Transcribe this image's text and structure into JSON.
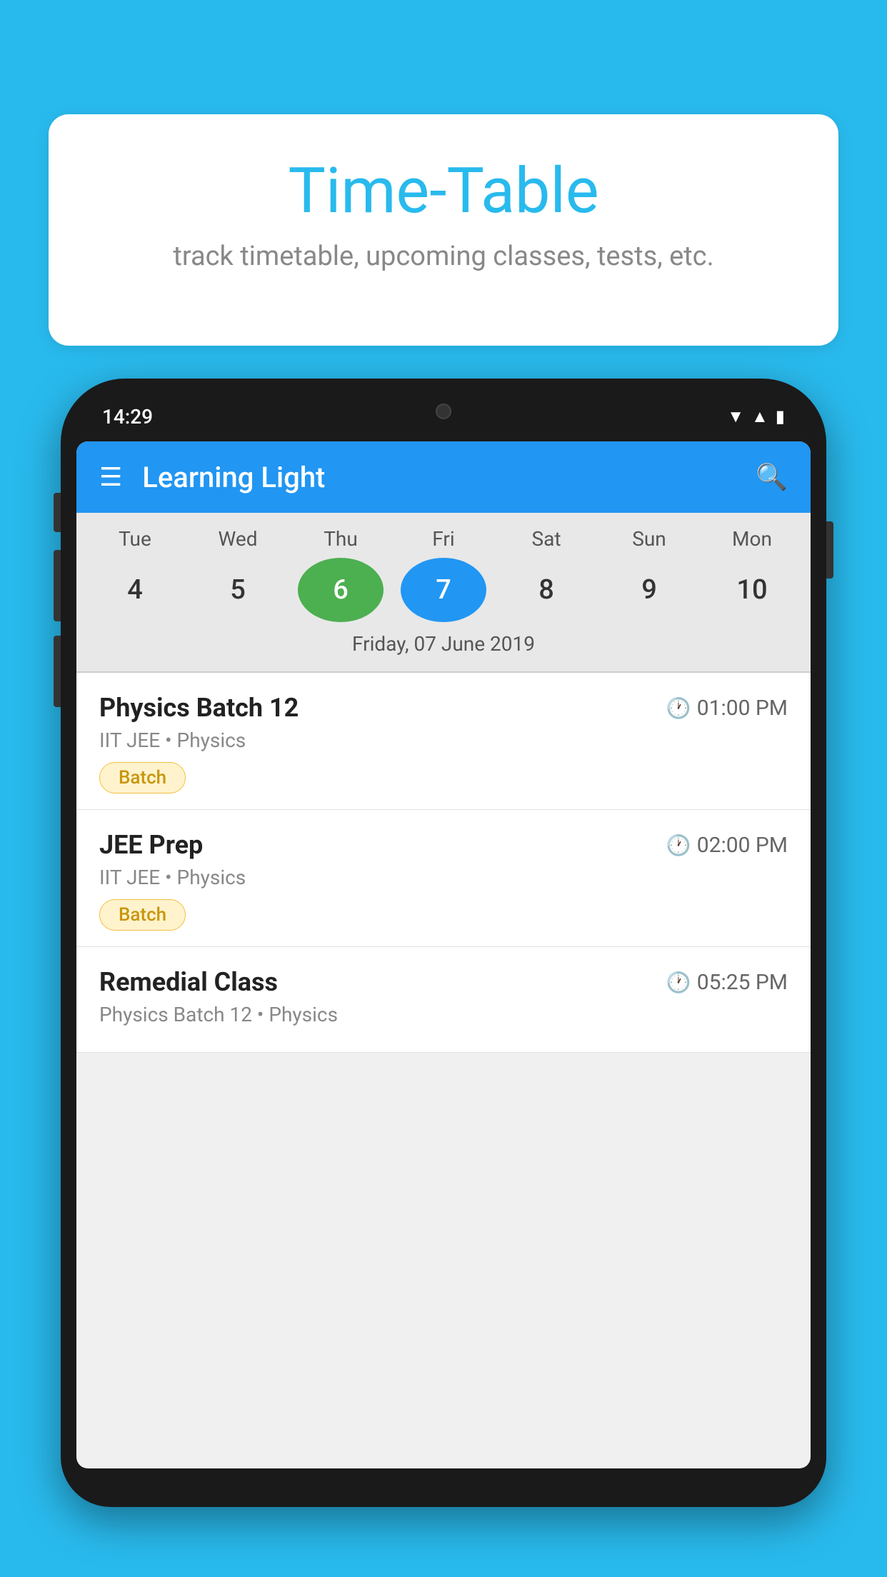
{
  "background_color": "#29BAED",
  "speech_bubble": {
    "title": "Time-Table",
    "subtitle": "track timetable, upcoming classes, tests, etc."
  },
  "phone": {
    "status_bar": {
      "time": "14:29"
    },
    "app_bar": {
      "title": "Learning Light",
      "menu_icon": "hamburger-icon",
      "search_icon": "search-icon"
    },
    "calendar": {
      "days": [
        {
          "label": "Tue",
          "number": "4"
        },
        {
          "label": "Wed",
          "number": "5"
        },
        {
          "label": "Thu",
          "number": "6",
          "state": "today"
        },
        {
          "label": "Fri",
          "number": "7",
          "state": "selected"
        },
        {
          "label": "Sat",
          "number": "8"
        },
        {
          "label": "Sun",
          "number": "9"
        },
        {
          "label": "Mon",
          "number": "10"
        }
      ],
      "selected_date_label": "Friday, 07 June 2019"
    },
    "schedule": [
      {
        "title": "Physics Batch 12",
        "time": "01:00 PM",
        "subtitle": "IIT JEE • Physics",
        "badge": "Batch"
      },
      {
        "title": "JEE Prep",
        "time": "02:00 PM",
        "subtitle": "IIT JEE • Physics",
        "badge": "Batch"
      },
      {
        "title": "Remedial Class",
        "time": "05:25 PM",
        "subtitle": "Physics Batch 12 • Physics",
        "badge": null
      }
    ]
  }
}
